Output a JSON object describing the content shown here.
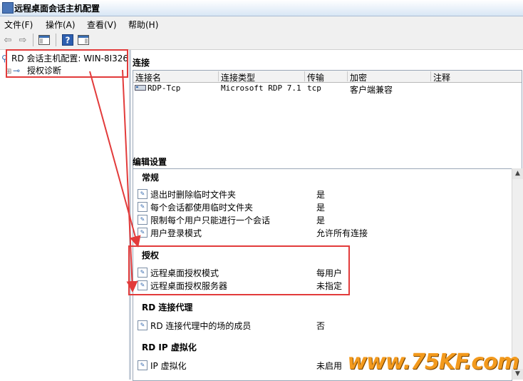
{
  "window": {
    "title": "远程桌面会话主机配置"
  },
  "menu": [
    "文件(F)",
    "操作(A)",
    "查看(V)",
    "帮助(H)"
  ],
  "tree": {
    "root": "RD 会话主机配置: WIN-8I326",
    "child": "授权诊断"
  },
  "connections": {
    "title": "连接",
    "columns": [
      "连接名",
      "连接类型",
      "传输",
      "加密",
      "注释"
    ],
    "rows": [
      {
        "name": "RDP-Tcp",
        "type": "Microsoft RDP 7.1",
        "transport": "tcp",
        "encryption": "客户端兼容",
        "comment": ""
      }
    ]
  },
  "edit": {
    "title": "编辑设置",
    "groups": [
      {
        "name": "常规",
        "items": [
          {
            "label": "退出时删除临时文件夹",
            "value": "是"
          },
          {
            "label": "每个会话都使用临时文件夹",
            "value": "是"
          },
          {
            "label": "限制每个用户只能进行一个会话",
            "value": "是"
          },
          {
            "label": "用户登录模式",
            "value": "允许所有连接"
          }
        ]
      },
      {
        "name": "授权",
        "items": [
          {
            "label": "远程桌面授权模式",
            "value": "每用户"
          },
          {
            "label": "远程桌面授权服务器",
            "value": "未指定"
          }
        ]
      },
      {
        "name": "RD 连接代理",
        "items": [
          {
            "label": "RD 连接代理中的场的成员",
            "value": "否"
          }
        ]
      },
      {
        "name": "RD IP 虚拟化",
        "items": [
          {
            "label": "IP 虚拟化",
            "value": "未启用"
          }
        ]
      }
    ]
  },
  "watermark": "www.75KF.com",
  "colors": {
    "annotation": "#e23b3b",
    "watermark": "#f39a1d"
  }
}
